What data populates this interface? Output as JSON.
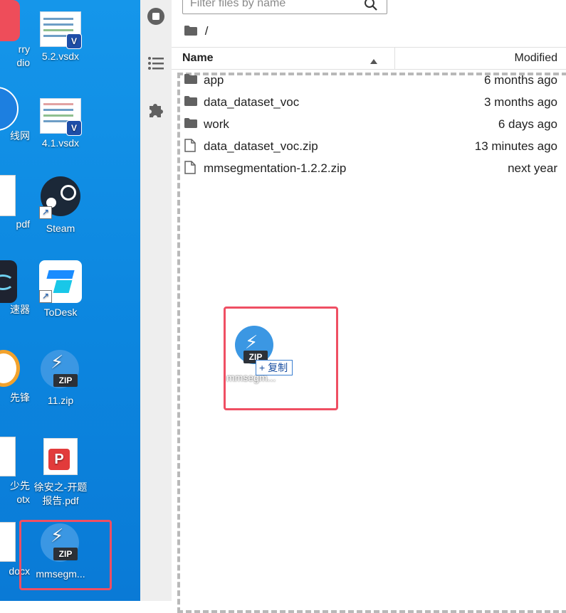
{
  "desktop": {
    "col1": [
      {
        "label": "rry",
        "label2": "dio"
      },
      {
        "label": "线网",
        "label2": ""
      },
      {
        "label": "pdf",
        "label2": ""
      },
      {
        "label": "速器",
        "label2": ""
      },
      {
        "label": "先锋",
        "label2": ""
      },
      {
        "label": "少先",
        "label2": "otx"
      },
      {
        "label": "docx",
        "label2": ""
      }
    ],
    "col2": [
      {
        "label": "5.2.vsdx",
        "icon": "vsdx-file-icon"
      },
      {
        "label": "4.1.vsdx",
        "icon": "vsdx-file-icon"
      },
      {
        "label": "Steam",
        "icon": "steam-icon"
      },
      {
        "label": "ToDesk",
        "icon": "todesk-icon"
      },
      {
        "label": "11.zip",
        "icon": "zip-file-icon"
      },
      {
        "label": "徐安之-开题",
        "label2": "报告.pdf",
        "icon": "pdf-file-icon"
      },
      {
        "label": "mmsegm...",
        "icon": "zip-file-icon"
      }
    ],
    "badge_v": "V",
    "zip_tag": "ZIP"
  },
  "sidebar": {
    "items": [
      {
        "name": "running-terminals-icon"
      },
      {
        "name": "table-of-contents-icon"
      },
      {
        "name": "extensions-icon"
      }
    ]
  },
  "filebrowser": {
    "filter_placeholder": "Filter files by name",
    "breadcrumb": "/",
    "header": {
      "name": "Name",
      "modified": "Modified"
    },
    "files": [
      {
        "name": "app",
        "type": "folder",
        "modified": "6 months ago"
      },
      {
        "name": "data_dataset_voc",
        "type": "folder",
        "modified": "3 months ago"
      },
      {
        "name": "work",
        "type": "folder",
        "modified": "6 days ago"
      },
      {
        "name": "data_dataset_voc.zip",
        "type": "file",
        "modified": "13 minutes ago"
      },
      {
        "name": "mmsegmentation-1.2.2.zip",
        "type": "file",
        "modified": "next year"
      }
    ]
  },
  "drag": {
    "label": "mmsegm...",
    "tooltip": "+ 复制"
  },
  "colors": {
    "desktop_bg": "#0c86df",
    "highlight": "#ef4f63",
    "zip_blue": "#3b97e3"
  }
}
